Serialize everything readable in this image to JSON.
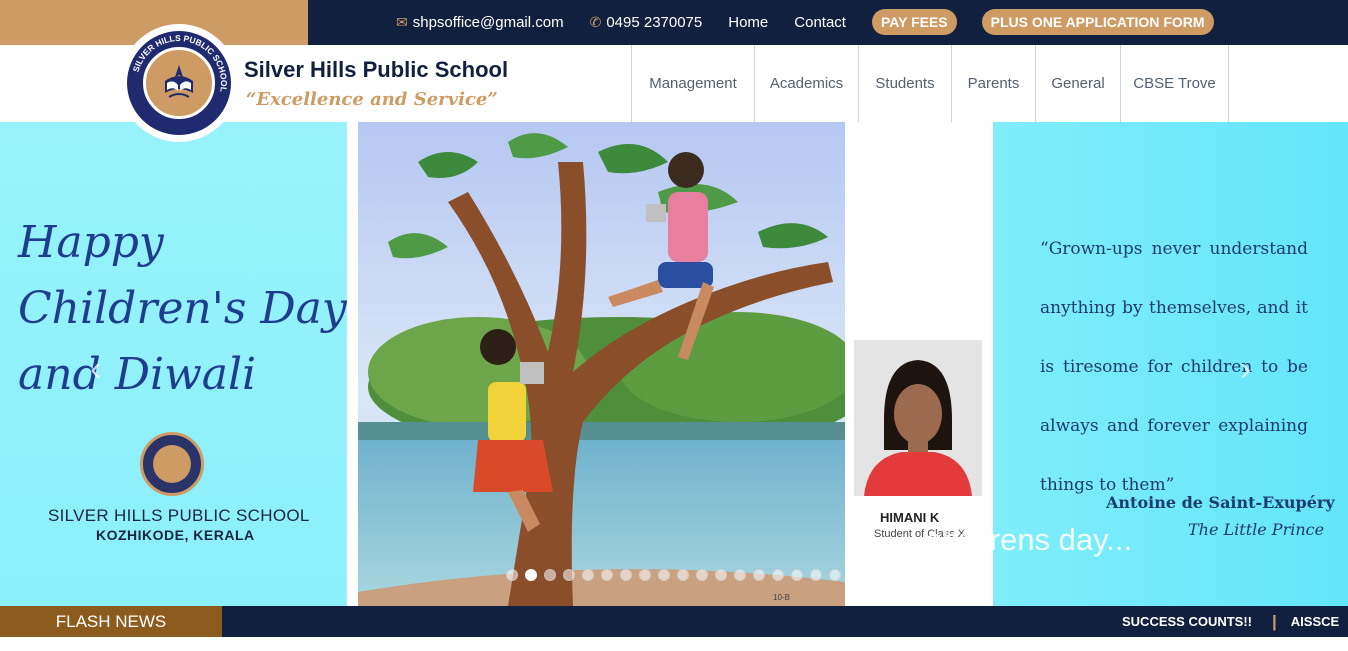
{
  "topbar": {
    "email": "shpsoffice@gmail.com",
    "phone": "0495 2370075",
    "links": [
      "Home",
      "Contact"
    ],
    "pay_fees": "PAY FEES",
    "application": "PLUS ONE APPLICATION FORM",
    "icons": {
      "email": "envelope-icon",
      "phone": "phone-icon"
    }
  },
  "header": {
    "school_name": "Silver Hills Public School",
    "motto": "“Excellence and Service”",
    "logo_text": "SILVER HILLS PUBLIC SCHOOL",
    "nav": [
      "Management",
      "Academics",
      "Students",
      "Parents",
      "General",
      "CBSE Trove"
    ]
  },
  "slider": {
    "greeting_lines": [
      "Happy",
      "Children's Day",
      "and Diwali"
    ],
    "school": "SILVER HILLS PUBLIC SCHOOL",
    "place": "KOZHIKODE, KERALA",
    "student_name": "HIMANI K",
    "student_class": "Student of Class X",
    "quote": "“Grown-ups never understand anything by themselves, and it is tiresome for children to be always and forever explaining things to them”",
    "author": "Antoine de Saint-Exupéry",
    "book": "The Little Prince",
    "caption": "childrens day...",
    "dot_count": 18,
    "active_dot": 2,
    "prev": "‹",
    "next": "›"
  },
  "news": {
    "label": "FLASH NEWS",
    "items": [
      "SUCCESS COUNTS!!",
      "AISSCE"
    ]
  },
  "colors": {
    "navy": "#12203f",
    "gold": "#cd9b63",
    "brown": "#8c5c1e"
  }
}
